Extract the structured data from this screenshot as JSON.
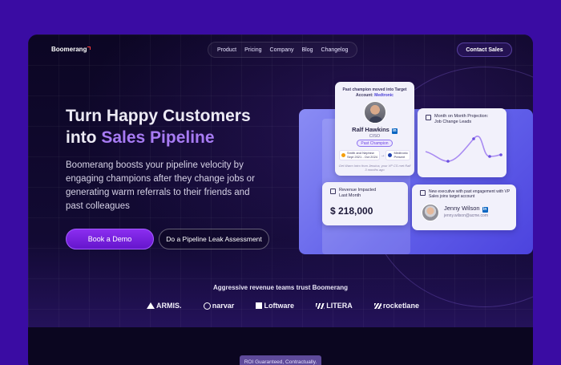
{
  "brand": {
    "name": "Boomerang",
    "accent": "#ff3b3b"
  },
  "nav": {
    "items": [
      "Product",
      "Pricing",
      "Company",
      "Blog",
      "Changelog"
    ],
    "cta": "Contact Sales"
  },
  "hero": {
    "heading_line1": "Turn Happy Customers",
    "heading_line2_prefix": "into ",
    "heading_line2_accent": "Sales Pipeline",
    "description": "Boomerang boosts your pipeline velocity by engaging champions after they change jobs or generating warm referrals to their friends and past colleagues",
    "primary_cta": "Book a Demo",
    "secondary_cta": "Do a Pipeline Leak Assessment",
    "accent_color": "#a77bf3"
  },
  "champion_card": {
    "title": "Past champion moved into Target Account: ",
    "title_account": "Medtronic",
    "name": "Ralf Hawkins",
    "role": "CISO",
    "badge": "Past Champion",
    "from_company": "Smith and Nephew",
    "from_dates": "Sept 2021 - Oct 2024",
    "to_company": "Medtronic",
    "to_dates": "Present",
    "note": "Get Warm Intro from Jessica, your VP CS met Ralf 3 months ago"
  },
  "projection_card": {
    "title_line1": "Month on Month Projection:",
    "title_line2": "Job Change Leads"
  },
  "revenue_card": {
    "title_line1": "Revenue Impacted",
    "title_line2": "Last Month",
    "value": "$ 218,000"
  },
  "exec_card": {
    "title": "New executive with past engagement with VP Sales joins target account",
    "name": "Jenny Wilson",
    "email": "jenny.wilson@acme.com"
  },
  "trust": {
    "heading": "Aggressive revenue teams trust Boomerang",
    "logos": [
      "ARMIS.",
      "narvar",
      "Loftware",
      "LITERA",
      "rocketlane"
    ]
  },
  "footer_badge": "ROI Guaranteed, Contractually."
}
